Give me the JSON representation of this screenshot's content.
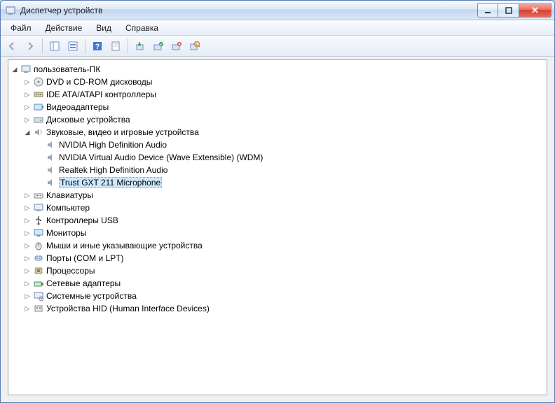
{
  "window": {
    "title": "Диспетчер устройств"
  },
  "menu": {
    "file": "Файл",
    "action": "Действие",
    "view": "Вид",
    "help": "Справка"
  },
  "tree": {
    "root": "пользователь-ПК",
    "categories": {
      "dvd": "DVD и CD-ROM дисководы",
      "ide": "IDE ATA/ATAPI контроллеры",
      "video": "Видеоадаптеры",
      "disk": "Дисковые устройства",
      "sound": "Звуковые, видео и игровые устройства",
      "keyboard": "Клавиатуры",
      "computer": "Компьютер",
      "usb": "Контроллеры USB",
      "monitor": "Мониторы",
      "mouse": "Мыши и иные указывающие устройства",
      "ports": "Порты (COM и LPT)",
      "cpu": "Процессоры",
      "net": "Сетевые адаптеры",
      "system": "Системные устройства",
      "hid": "Устройства HID (Human Interface Devices)"
    },
    "sound_children": {
      "nvidia_hd": "NVIDIA High Definition Audio",
      "nvidia_vad": "NVIDIA Virtual Audio Device (Wave Extensible) (WDM)",
      "realtek": "Realtek High Definition Audio",
      "trust": "Trust GXT 211 Microphone"
    }
  }
}
